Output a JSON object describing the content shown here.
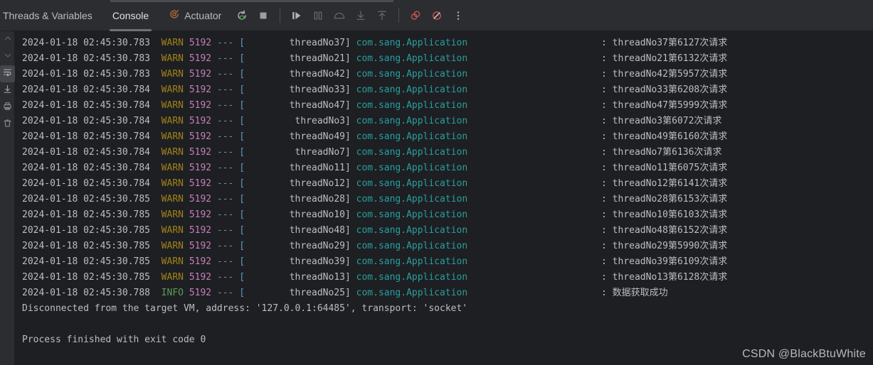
{
  "window": {
    "background": "#1e1f22",
    "toolbar_background": "#2b2d30"
  },
  "toolbar": {
    "tabs": [
      {
        "label": "Threads & Variables",
        "active": false,
        "clipped": true
      },
      {
        "label": "Console",
        "active": true,
        "clipped": false
      },
      {
        "label": "Actuator",
        "active": false,
        "clipped": false,
        "icon": "actuator-icon"
      }
    ],
    "buttons": [
      {
        "name": "rerun-button",
        "icon": "rerun-with-debug-icon",
        "enabled": true
      },
      {
        "name": "stop-button",
        "icon": "stop-square-icon",
        "enabled": true
      },
      {
        "name": "resume-program-button",
        "icon": "resume-icon",
        "enabled": true
      },
      {
        "name": "pause-program-button",
        "icon": "pause-icon",
        "enabled": false
      },
      {
        "name": "step-over-button",
        "icon": "step-over-icon",
        "enabled": false
      },
      {
        "name": "step-into-button",
        "icon": "step-into-icon",
        "enabled": false
      },
      {
        "name": "step-out-button",
        "icon": "step-out-icon",
        "enabled": false
      },
      {
        "name": "view-breakpoints-button",
        "icon": "breakpoints-icon",
        "enabled": true
      },
      {
        "name": "mute-breakpoints-button",
        "icon": "mute-breakpoints-icon",
        "enabled": true
      },
      {
        "name": "more-options-button",
        "icon": "more-vertical-icon",
        "enabled": true
      }
    ]
  },
  "gutter": {
    "buttons": [
      {
        "name": "scroll-up-icon",
        "icon": "chevron-up-icon"
      },
      {
        "name": "scroll-down-icon",
        "icon": "chevron-down-icon"
      },
      {
        "name": "soft-wrap-icon",
        "icon": "soft-wrap-icon",
        "selected": true
      },
      {
        "name": "scroll-to-end-icon",
        "icon": "scroll-to-end-icon"
      },
      {
        "name": "print-icon",
        "icon": "print-icon"
      },
      {
        "name": "clear-all-icon",
        "icon": "trash-icon"
      }
    ]
  },
  "console": {
    "colors": {
      "timestamp": "#bcbec4",
      "warn": "#a1821a",
      "info": "#5a9e5a",
      "pid": "#c77dbb",
      "logger": "#279f9f",
      "message": "#bcbec4"
    },
    "pid": "5192",
    "separator": "---",
    "logger_name": "com.sang.Application",
    "lines": [
      {
        "type": "log",
        "timestamp": "2024-01-18 02:45:30.783",
        "level": "WARN",
        "thread": "threadNo37",
        "message": "threadNo37第6127次请求"
      },
      {
        "type": "log",
        "timestamp": "2024-01-18 02:45:30.783",
        "level": "WARN",
        "thread": "threadNo21",
        "message": "threadNo21第6132次请求"
      },
      {
        "type": "log",
        "timestamp": "2024-01-18 02:45:30.783",
        "level": "WARN",
        "thread": "threadNo42",
        "message": "threadNo42第5957次请求"
      },
      {
        "type": "log",
        "timestamp": "2024-01-18 02:45:30.784",
        "level": "WARN",
        "thread": "threadNo33",
        "message": "threadNo33第6208次请求"
      },
      {
        "type": "log",
        "timestamp": "2024-01-18 02:45:30.784",
        "level": "WARN",
        "thread": "threadNo47",
        "message": "threadNo47第5999次请求"
      },
      {
        "type": "log",
        "timestamp": "2024-01-18 02:45:30.784",
        "level": "WARN",
        "thread": "threadNo3",
        "message": "threadNo3第6072次请求"
      },
      {
        "type": "log",
        "timestamp": "2024-01-18 02:45:30.784",
        "level": "WARN",
        "thread": "threadNo49",
        "message": "threadNo49第6160次请求"
      },
      {
        "type": "log",
        "timestamp": "2024-01-18 02:45:30.784",
        "level": "WARN",
        "thread": "threadNo7",
        "message": "threadNo7第6136次请求"
      },
      {
        "type": "log",
        "timestamp": "2024-01-18 02:45:30.784",
        "level": "WARN",
        "thread": "threadNo11",
        "message": "threadNo11第6075次请求"
      },
      {
        "type": "log",
        "timestamp": "2024-01-18 02:45:30.784",
        "level": "WARN",
        "thread": "threadNo12",
        "message": "threadNo12第6141次请求"
      },
      {
        "type": "log",
        "timestamp": "2024-01-18 02:45:30.785",
        "level": "WARN",
        "thread": "threadNo28",
        "message": "threadNo28第6153次请求"
      },
      {
        "type": "log",
        "timestamp": "2024-01-18 02:45:30.785",
        "level": "WARN",
        "thread": "threadNo10",
        "message": "threadNo10第6103次请求"
      },
      {
        "type": "log",
        "timestamp": "2024-01-18 02:45:30.785",
        "level": "WARN",
        "thread": "threadNo48",
        "message": "threadNo48第6152次请求"
      },
      {
        "type": "log",
        "timestamp": "2024-01-18 02:45:30.785",
        "level": "WARN",
        "thread": "threadNo29",
        "message": "threadNo29第5990次请求"
      },
      {
        "type": "log",
        "timestamp": "2024-01-18 02:45:30.785",
        "level": "WARN",
        "thread": "threadNo39",
        "message": "threadNo39第6109次请求"
      },
      {
        "type": "log",
        "timestamp": "2024-01-18 02:45:30.785",
        "level": "WARN",
        "thread": "threadNo13",
        "message": "threadNo13第6128次请求"
      },
      {
        "type": "log",
        "timestamp": "2024-01-18 02:45:30.788",
        "level": "INFO",
        "thread": "threadNo25",
        "message": "数据获取成功"
      },
      {
        "type": "plain",
        "text": "Disconnected from the target VM, address: '127.0.0.1:64485', transport: 'socket'"
      },
      {
        "type": "plain",
        "text": ""
      },
      {
        "type": "plain",
        "text": "Process finished with exit code 0"
      }
    ]
  },
  "watermark": {
    "text": "CSDN @BlackBtuWhite"
  }
}
